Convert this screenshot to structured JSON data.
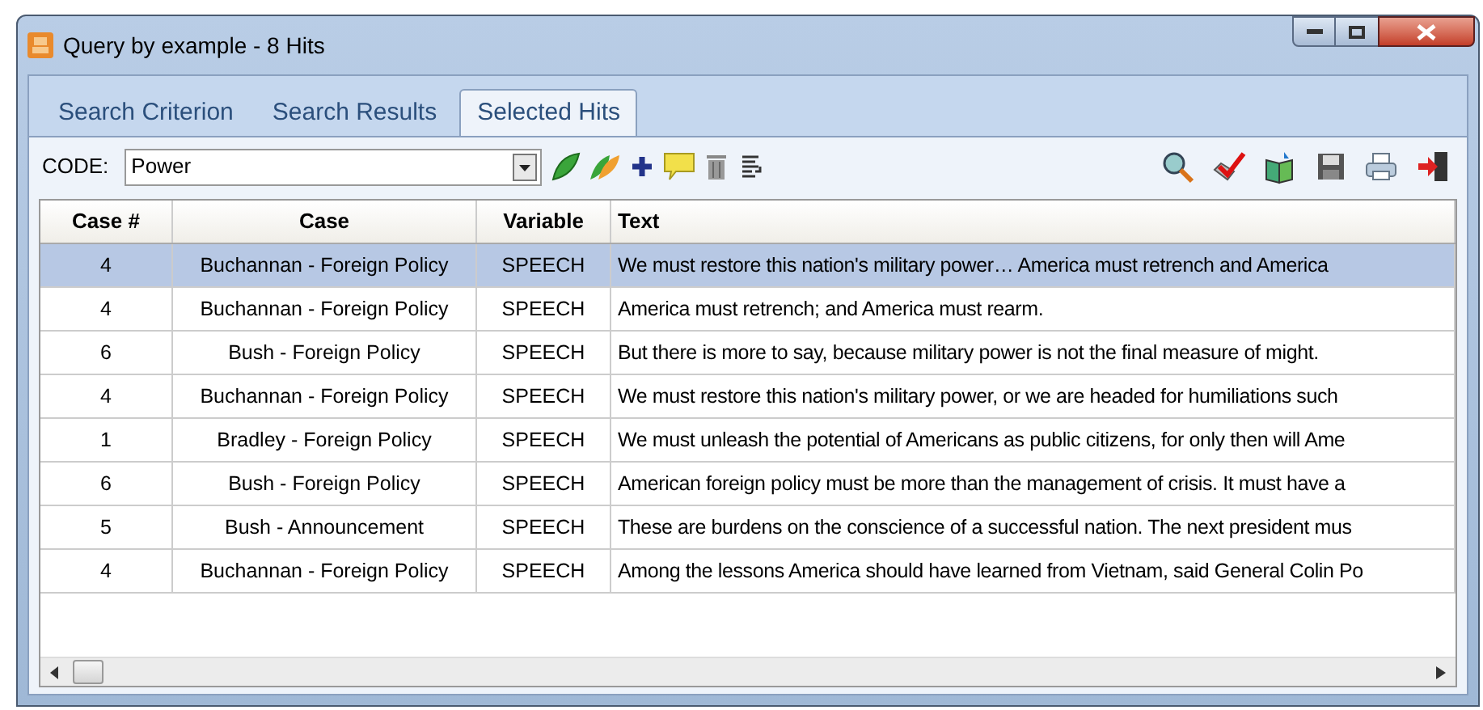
{
  "window": {
    "title": "Query by example - 8 Hits"
  },
  "tabs": [
    {
      "label": "Search Criterion",
      "selected": false
    },
    {
      "label": "Search Results",
      "selected": false
    },
    {
      "label": "Selected Hits",
      "selected": true
    }
  ],
  "toolbar": {
    "code_label": "CODE:",
    "code_value": "Power"
  },
  "table": {
    "columns": [
      "Case #",
      "Case",
      "Variable",
      "Text"
    ],
    "rows": [
      {
        "cells": [
          "4",
          "Buchannan - Foreign Policy",
          "SPEECH",
          "We must restore this nation's military power… America must retrench and America"
        ],
        "selected": true
      },
      {
        "cells": [
          "4",
          "Buchannan - Foreign Policy",
          "SPEECH",
          "America must retrench; and America must rearm."
        ],
        "selected": false
      },
      {
        "cells": [
          "6",
          "Bush - Foreign Policy",
          "SPEECH",
          "But there is more to say, because military power is not the final measure of might."
        ],
        "selected": false
      },
      {
        "cells": [
          "4",
          "Buchannan - Foreign Policy",
          "SPEECH",
          "We must restore this nation's military power, or we are headed for humiliations such"
        ],
        "selected": false
      },
      {
        "cells": [
          "1",
          "Bradley - Foreign Policy",
          "SPEECH",
          "We must unleash the potential of Americans as public citizens, for only then will Ame"
        ],
        "selected": false
      },
      {
        "cells": [
          "6",
          "Bush - Foreign Policy",
          "SPEECH",
          "American foreign policy must be more than the management of crisis. It must have a"
        ],
        "selected": false
      },
      {
        "cells": [
          "5",
          "Bush - Announcement",
          "SPEECH",
          "These are burdens on the conscience of a successful nation. The next president mus"
        ],
        "selected": false
      },
      {
        "cells": [
          "4",
          "Buchannan - Foreign Policy",
          "SPEECH",
          "Among the lessons America should have learned from Vietnam, said General Colin Po"
        ],
        "selected": false
      }
    ]
  }
}
